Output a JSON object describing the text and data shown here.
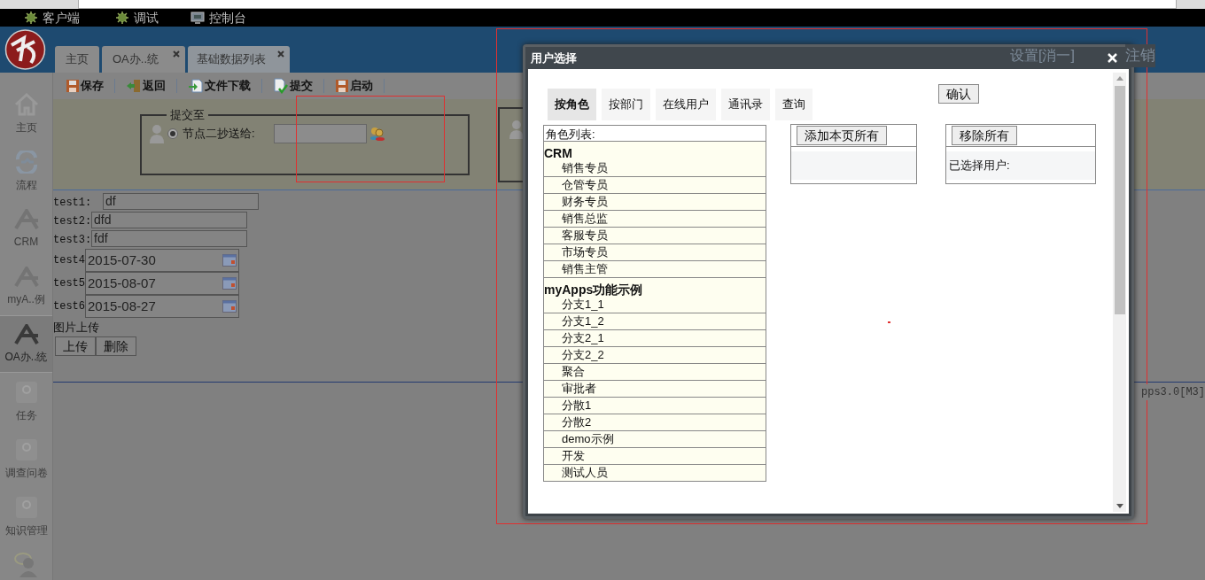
{
  "top_bar": {
    "items": [
      {
        "label": "客户端",
        "kind": "bug"
      },
      {
        "label": "调试",
        "kind": "bug"
      },
      {
        "label": "控制台",
        "kind": "monitor"
      }
    ]
  },
  "header": {
    "tabs": [
      {
        "label": "主页",
        "closable": false,
        "selected": false
      },
      {
        "label": "OA办..统",
        "closable": true,
        "selected": false
      },
      {
        "label": "基础数据列表",
        "closable": true,
        "selected": true
      }
    ],
    "user_links": [
      "设置[消一]",
      "注销"
    ]
  },
  "sidebar": {
    "items": [
      {
        "label": "主页",
        "kind": "home",
        "selected": false
      },
      {
        "label": "流程",
        "kind": "flow",
        "selected": false
      },
      {
        "label": "CRM",
        "kind": "app",
        "selected": false
      },
      {
        "label": "myA..例",
        "kind": "app",
        "selected": false
      },
      {
        "label": "OA办..统",
        "kind": "app",
        "selected": true
      },
      {
        "label": "任务",
        "kind": "module",
        "selected": false
      },
      {
        "label": "调查问卷",
        "kind": "module",
        "selected": false
      },
      {
        "label": "知识管理",
        "kind": "module",
        "selected": false
      }
    ]
  },
  "toolbar": {
    "buttons": [
      {
        "label": "保存",
        "kind": "save"
      },
      {
        "label": "返回",
        "kind": "back"
      },
      {
        "label": "文件下载",
        "kind": "download"
      },
      {
        "label": "提交",
        "kind": "submit"
      },
      {
        "label": "启动",
        "kind": "save"
      }
    ]
  },
  "submit_to": {
    "legend": "提交至",
    "option": {
      "label": "节点二抄送给:",
      "selected": true
    }
  },
  "form": {
    "fields": [
      {
        "label": "test1:",
        "value": "df",
        "kind": "text"
      },
      {
        "label": "test2:",
        "value": "dfd",
        "kind": "text"
      },
      {
        "label": "test3:",
        "value": "fdf",
        "kind": "text"
      },
      {
        "label": "test4",
        "value": "2015-07-30",
        "kind": "date"
      },
      {
        "label": "test5",
        "value": "2015-08-07",
        "kind": "date"
      },
      {
        "label": "test6",
        "value": "2015-08-27",
        "kind": "date"
      }
    ],
    "upload_label": "图片上传",
    "upload_buttons": [
      "上传",
      "删除"
    ]
  },
  "footer_text": "pps3.0[M3]",
  "dialog": {
    "title": "用户选择",
    "tabs": [
      {
        "label": "按角色",
        "selected": true
      },
      {
        "label": "按部门",
        "selected": false
      },
      {
        "label": "在线用户",
        "selected": false
      },
      {
        "label": "通讯录",
        "selected": false
      },
      {
        "label": "查询",
        "selected": false
      }
    ],
    "confirm_button": "确认",
    "role_list": {
      "header": "角色列表:",
      "groups": [
        {
          "name": "CRM",
          "roles": [
            "销售专员",
            "仓管专员",
            "财务专员",
            "销售总监",
            "客服专员",
            "市场专员",
            "销售主管"
          ]
        },
        {
          "name": "myApps功能示例",
          "roles": [
            "分支1_1",
            "分支1_2",
            "分支2_1",
            "分支2_2",
            "聚合",
            "审批者",
            "分散1",
            "分散2",
            "demo示例",
            "开发",
            "测试人员"
          ]
        }
      ]
    },
    "add_all_button": "添加本页所有",
    "remove_all_button": "移除所有",
    "selected_users_label": "已选择用户:"
  }
}
